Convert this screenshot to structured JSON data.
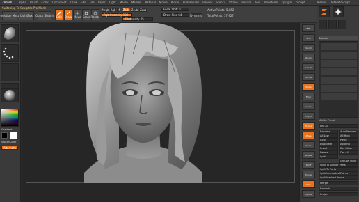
{
  "menubar": {
    "title": "ZBrush",
    "items": [
      "Alpha",
      "Brush",
      "Color",
      "Document",
      "Draw",
      "Edit",
      "File",
      "Layer",
      "Light",
      "Macro",
      "Marker",
      "Material",
      "Movie",
      "Picker",
      "Preferences",
      "Render",
      "Stencil",
      "Stroke",
      "Texture",
      "Tool",
      "Transform",
      "Zplugin",
      "Zscript"
    ],
    "right": [
      "Menus",
      "DefaultZScript"
    ]
  },
  "topbar": {
    "notice": "Switching To Sculptris Pro Mode",
    "projection_master": "Projection Master",
    "lightbox": "LightBox",
    "quick_sketch": "Quick Sketch",
    "edit": "Edit",
    "draw": "Draw",
    "move": "Move",
    "scale": "Scale",
    "rotate": "Rotate",
    "mrgb": "Mrgb",
    "rgb": "Rgb",
    "m": "M",
    "zadd": "Zadd",
    "zsub": "Zsub",
    "zcut": "Zcut",
    "rgb_intensity": "Rgb Intensity 100",
    "z_intensity": "Z Intensity 25",
    "focal_shift": "Focal Shift 0",
    "draw_size": "Draw Size 64",
    "dynamic": "Dynamic",
    "active_points": "ActivePoints: 5,852",
    "total_points": "TotalPoints: 57,927",
    "z_intensity_fraction": 0.25,
    "rgb_intensity_fraction": 1.0
  },
  "left_shelf": {
    "gradient": "Gradient",
    "switch_color": "SwitchColor",
    "alternate": "Alternate",
    "colors": {
      "main": "#ffffff",
      "secondary": "#000000"
    }
  },
  "right_shelf": {
    "buttons": [
      "BPR",
      "SPix",
      "Scroll",
      "Zoom",
      "Actual",
      "AAHalf",
      "Persp",
      "Floor",
      "Local",
      "LSym",
      "Frame",
      "Move",
      "Scale",
      "Rotate",
      "PolyF",
      "Transp",
      "Solo",
      "Xpose"
    ]
  },
  "tray": {
    "header": "Subtool",
    "list_count": "Visible Count",
    "buttons": [
      "List All",
      "Rename",
      "AutoReorder",
      "All Low",
      "All High",
      "Copy",
      "Paste",
      "Duplicate",
      "Append",
      "Insert",
      "Del Other",
      "Delete",
      "Del All",
      "Split",
      "Groups Split",
      "Split To Similar Parts",
      "Split To Parts",
      "Split Unmasked Points",
      "Split Masked Points",
      "Merge",
      "Remesh",
      "Project"
    ]
  },
  "colors": {
    "accent": "#e8731c",
    "panel": "#3b3b3b",
    "canvas": "#262626"
  }
}
